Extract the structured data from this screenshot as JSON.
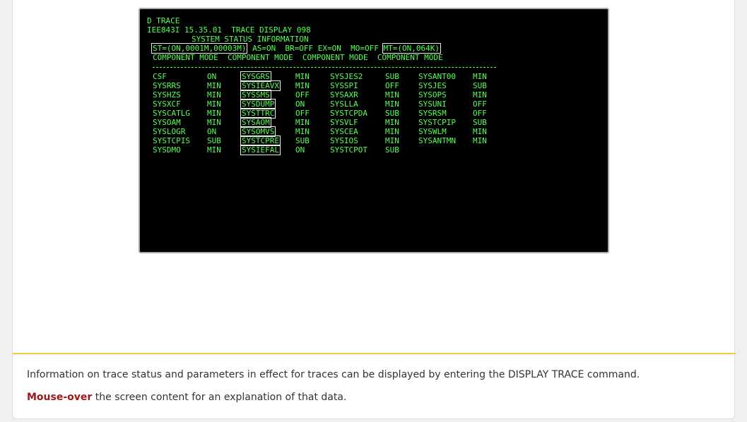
{
  "terminal": {
    "command": "D TRACE",
    "line2": "IEE843I 15.35.01  TRACE DISPLAY 098",
    "line3": "SYSTEM STATUS INFORMATION",
    "st_box": "ST=(ON,0001M,00003M)",
    "params_mid": " AS=ON  BR=OFF EX=ON  MO=OFF ",
    "mt_box": "MT=(ON,064K)",
    "header": "COMPONENT MODE  COMPONENT MODE  COMPONENT MODE  COMPONENT MODE",
    "columns": [
      {
        "components": [
          "CSF",
          "SYSRRS",
          "SYSHZS",
          "SYSXCF",
          "SYSCATLG",
          "SYSOAM",
          "SYSLOGR",
          "SYSTCPIS",
          "SYSDMO"
        ],
        "modes": [
          "ON",
          "MIN",
          "MIN",
          "MIN",
          "MIN",
          "MIN",
          "ON",
          "SUB",
          "MIN"
        ]
      },
      {
        "components": [
          "SYSGRS",
          "SYSIEAVX",
          "SYSSMS",
          "SYSDUMP",
          "SYSTTRC",
          "SYSAOM",
          "SYSOMVS",
          "SYSTCPRE",
          "SYSIEFAL"
        ],
        "modes": [
          "MIN",
          "MIN",
          "OFF",
          "ON",
          "OFF",
          "MIN",
          "MIN",
          "SUB",
          "ON"
        ]
      },
      {
        "components": [
          "SYSJES2",
          "SYSSPI",
          "SYSAXR",
          "SYSLLA",
          "SYSTCPDA",
          "SYSVLF",
          "SYSCEA",
          "SYSIOS",
          "SYSTCPOT"
        ],
        "modes": [
          "SUB",
          "OFF",
          "MIN",
          "MIN",
          "SUB",
          "MIN",
          "MIN",
          "MIN",
          "SUB"
        ]
      },
      {
        "components": [
          "SYSANT00",
          "SYSJES",
          "SYSOPS",
          "SYSUNI",
          "SYSRSM",
          "SYSTCPIP",
          "SYSWLM",
          "SYSANTMN"
        ],
        "modes": [
          "MIN",
          "SUB",
          "MIN",
          "OFF",
          "OFF",
          "SUB",
          "MIN",
          "MIN"
        ]
      }
    ]
  },
  "info": {
    "text": "Information on trace status and parameters in effect for traces can be displayed by entering the DISPLAY TRACE command.",
    "mouseover_em": "Mouse-over",
    "mouseover_rest": " the screen content for an explanation of that data."
  },
  "colors": {
    "terminal_bg": "#000000",
    "terminal_text": "#55ff55",
    "divider": "#f2c94c",
    "emphasis": "#a31515"
  }
}
